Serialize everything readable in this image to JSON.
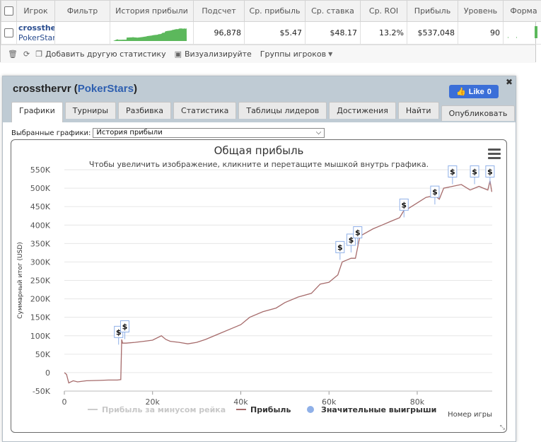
{
  "stats_table": {
    "headers": [
      "Игрок",
      "Фильтр",
      "История прибыли",
      "Подсчет",
      "Ср. прибыль",
      "Ср. ставка",
      "Ср. ROI",
      "Прибыль",
      "Уровень",
      "Форма"
    ],
    "row": {
      "player": "crossthervr",
      "site": "PokerStars",
      "filter": "",
      "count": "96,878",
      "avg_profit": "$5.47",
      "avg_stake": "$48.17",
      "avg_roi": "13.2%",
      "profit": "$537,048",
      "level": "90",
      "remove": "x"
    },
    "sparkline_color": "#5cb85c",
    "form_bar_color": "#5cb85c"
  },
  "toolbar": {
    "add_stat": "Добавить другую статистику",
    "visualize": "Визуализируйте",
    "player_groups": "Группы игроков"
  },
  "panel": {
    "player": "crossthervr",
    "site": "PokerStars",
    "like_label": "Like",
    "like_count": "0",
    "tabs": [
      "Графики",
      "Турниры",
      "Разбивка",
      "Статистика",
      "Таблицы лидеров",
      "Достижения",
      "Найти"
    ],
    "publish_tab": "Опубликовать",
    "select_label": "Выбранные графики:",
    "select_value": "История прибыли"
  },
  "chart_data": {
    "type": "line",
    "title": "Общая прибыль",
    "subtitle": "Чтобы увеличить изображение, кликните и перетащите мышкой внутрь графика.",
    "ylabel": "Суммарный итог (USD)",
    "xlabel": "Номер игры",
    "xlim": [
      0,
      97000
    ],
    "ylim": [
      -50000,
      550000
    ],
    "x_ticks": [
      "0",
      "20k",
      "40k",
      "60k",
      "80k"
    ],
    "y_ticks": [
      "-50K",
      "0",
      "50K",
      "100K",
      "150K",
      "200K",
      "250K",
      "300K",
      "350K",
      "400K",
      "450K",
      "500K",
      "550K"
    ],
    "legend": [
      "Прибыль за минусом рейка",
      "Прибыль",
      "Значительные выигрыши"
    ],
    "legend_colors": [
      "#cccccc",
      "#a66b6b",
      "#8fb0e8"
    ],
    "series": [
      {
        "name": "Прибыль",
        "color": "#a66b6b",
        "x": [
          0,
          500,
          1000,
          2000,
          3000,
          5000,
          8000,
          10000,
          12000,
          12800,
          13000,
          13200,
          14000,
          16000,
          18000,
          20000,
          22000,
          23000,
          24000,
          26000,
          28000,
          30000,
          32000,
          35000,
          38000,
          40000,
          42000,
          45000,
          48000,
          50000,
          53000,
          56000,
          58000,
          60000,
          61000,
          62000,
          63000,
          64000,
          65000,
          66000,
          66500,
          67000,
          70000,
          72000,
          74000,
          76000,
          77000,
          78000,
          80000,
          82000,
          84000,
          85000,
          86000,
          88000,
          90000,
          92000,
          94000,
          95000,
          96000,
          96500,
          96900
        ],
        "y": [
          0,
          -5000,
          -28000,
          -22000,
          -25000,
          -22000,
          -21000,
          -20000,
          -20000,
          -19000,
          90000,
          80000,
          80000,
          82000,
          85000,
          88000,
          100000,
          90000,
          85000,
          82000,
          78000,
          82000,
          90000,
          105000,
          120000,
          130000,
          150000,
          165000,
          175000,
          190000,
          205000,
          215000,
          240000,
          245000,
          255000,
          265000,
          300000,
          305000,
          310000,
          310000,
          340000,
          370000,
          390000,
          400000,
          410000,
          420000,
          440000,
          445000,
          460000,
          475000,
          480000,
          470000,
          500000,
          505000,
          510000,
          495000,
          505000,
          500000,
          495000,
          520000,
          490000
        ]
      }
    ],
    "big_win_markers": [
      {
        "x": 12300,
        "y": 95000
      },
      {
        "x": 13700,
        "y": 110000
      },
      {
        "x": 62500,
        "y": 325000
      },
      {
        "x": 65000,
        "y": 345000
      },
      {
        "x": 66500,
        "y": 365000
      },
      {
        "x": 77000,
        "y": 440000
      },
      {
        "x": 84000,
        "y": 475000
      },
      {
        "x": 88000,
        "y": 530000
      },
      {
        "x": 93000,
        "y": 530000
      },
      {
        "x": 96500,
        "y": 530000
      }
    ],
    "marker_label": "$",
    "grid": "horizontal"
  }
}
